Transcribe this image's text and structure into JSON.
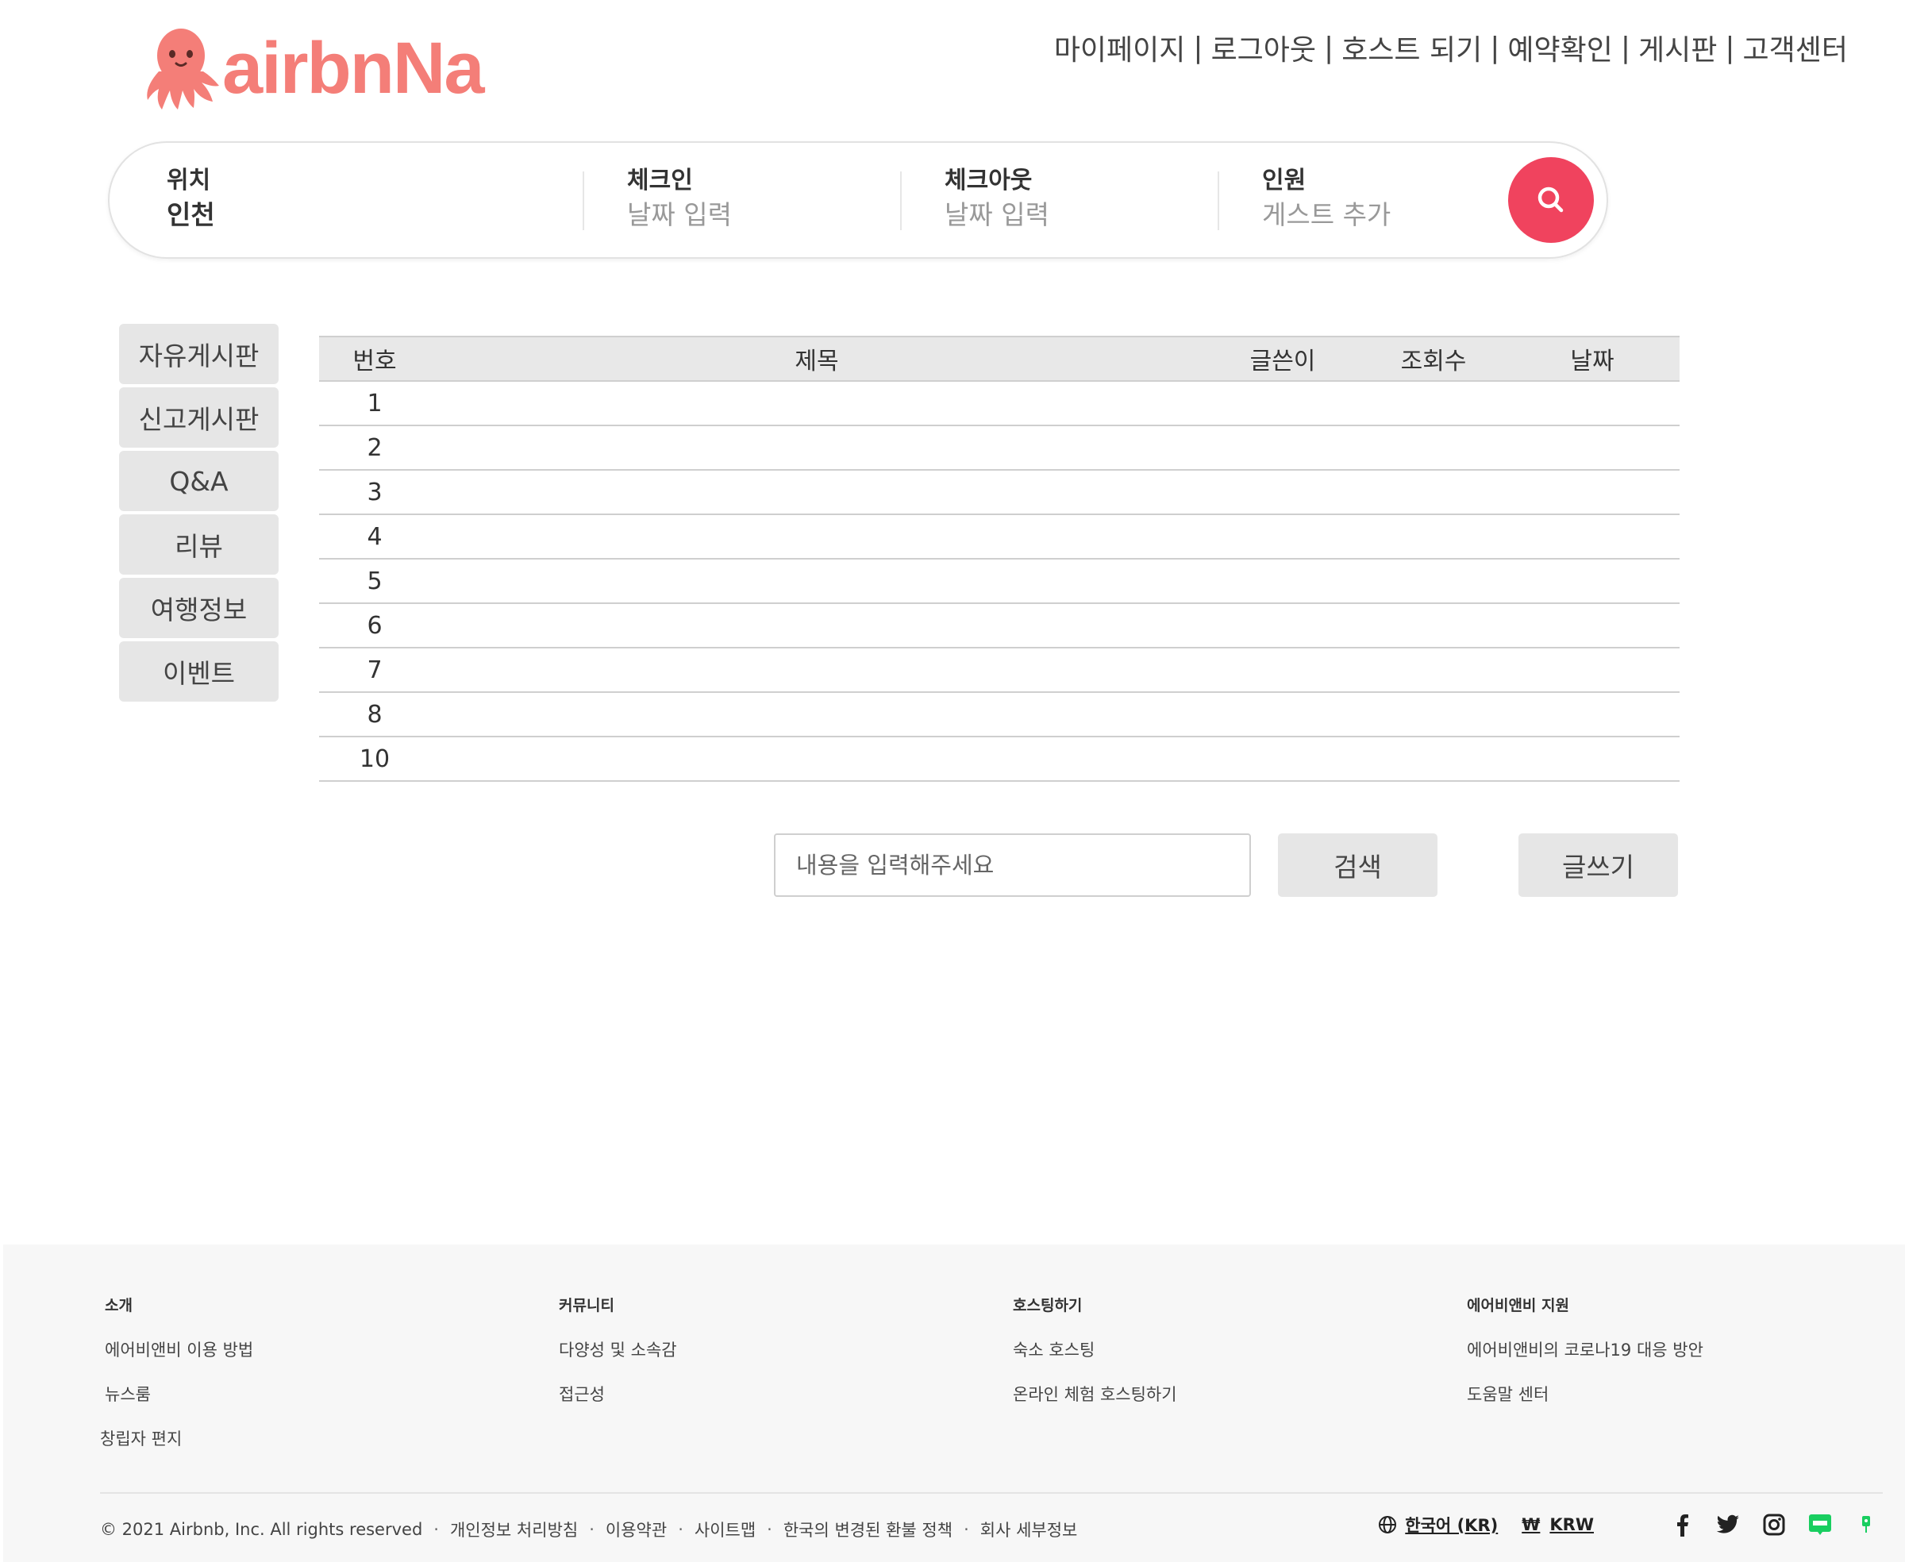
{
  "brand": {
    "logo_text": "airbnNa",
    "logo_color": "#f47e78",
    "mascot_icon": "octopus-mascot"
  },
  "topnav": {
    "items": [
      "마이페이지",
      "로그아웃",
      "호스트 되기",
      "예약확인",
      "게시판",
      "고객센터"
    ],
    "separator": "|"
  },
  "search": {
    "location_label": "위치",
    "location_value": "인천",
    "checkin_label": "체크인",
    "checkin_value": "날짜 입력",
    "checkout_label": "체크아웃",
    "checkout_value": "날짜 입력",
    "guests_label": "인원",
    "guests_value": "게스트 추가",
    "button_icon": "search-icon",
    "button_color": "#f0435e"
  },
  "sidebar": {
    "items": [
      "자유게시판",
      "신고게시판",
      "Q&A",
      "리뷰",
      "여행정보",
      "이벤트"
    ]
  },
  "board": {
    "columns": [
      "번호",
      "제목",
      "글쓴이",
      "조회수",
      "날짜"
    ],
    "rows": [
      {
        "no": "1",
        "title": "",
        "writer": "",
        "views": "",
        "date": ""
      },
      {
        "no": "2",
        "title": "",
        "writer": "",
        "views": "",
        "date": ""
      },
      {
        "no": "3",
        "title": "",
        "writer": "",
        "views": "",
        "date": ""
      },
      {
        "no": "4",
        "title": "",
        "writer": "",
        "views": "",
        "date": ""
      },
      {
        "no": "5",
        "title": "",
        "writer": "",
        "views": "",
        "date": ""
      },
      {
        "no": "6",
        "title": "",
        "writer": "",
        "views": "",
        "date": ""
      },
      {
        "no": "7",
        "title": "",
        "writer": "",
        "views": "",
        "date": ""
      },
      {
        "no": "8",
        "title": "",
        "writer": "",
        "views": "",
        "date": ""
      },
      {
        "no": "10",
        "title": "",
        "writer": "",
        "views": "",
        "date": ""
      }
    ]
  },
  "controls": {
    "search_placeholder": "내용을 입력해주세요",
    "search_button": "검색",
    "write_button": "글쓰기"
  },
  "footer": {
    "columns": [
      {
        "title": "소개",
        "links": [
          "에어비앤비 이용 방법",
          "뉴스룸",
          "창립자 편지"
        ]
      },
      {
        "title": "커뮤니티",
        "links": [
          "다양성 및 소속감",
          "접근성"
        ]
      },
      {
        "title": "호스팅하기",
        "links": [
          "숙소 호스팅",
          "온라인 체험 호스팅하기"
        ]
      },
      {
        "title": "에어비앤비 지원",
        "links": [
          "에어비앤비의 코로나19 대응 방안",
          "도움말 센터"
        ]
      }
    ],
    "copyright": "© 2021 Airbnb, Inc. All rights reserved",
    "legal_links": [
      "개인정보 처리방침",
      "이용약관",
      "사이트맵",
      "한국의 변경된 환불 정책",
      "회사 세부정보"
    ],
    "language": "한국어 (KR)",
    "currency_symbol": "₩",
    "currency": "KRW",
    "social_icons": [
      "facebook-icon",
      "twitter-icon",
      "instagram-icon",
      "naver-blog-icon",
      "naver-post-icon"
    ]
  }
}
